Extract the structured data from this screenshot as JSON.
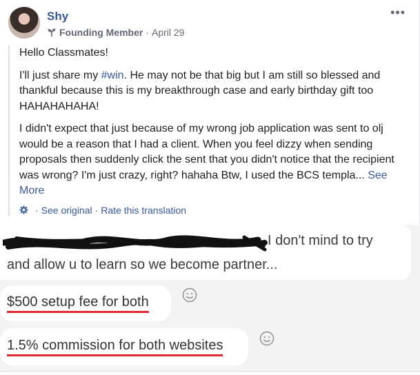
{
  "post": {
    "author": "Shy",
    "badge": "Founding Member",
    "separator": "·",
    "date": "April 29",
    "more_icon": "more-dots-icon",
    "greeting": "Hello Classmates!",
    "p2_before": "I'll just share my ",
    "p2_hashtag": "#win",
    "p2_after": ". He may not be that big but I am still so blessed and thankful because this is my breakthrough case and early birthday gift too HAHAHAHAHA!",
    "p3_text": "I didn't expect that just because of my wrong job application was sent to olj would be a reason that I had a client. When you feel dizzy when sending proposals then suddenly click the sent that you didn't notice that the recipient was wrong? I'm just crazy, right? hahaha Btw, I used the BCS templa...",
    "see_more": "See More",
    "see_original": "See original",
    "rate_translation": "Rate this translation"
  },
  "chat": {
    "top_line1": "I don't mind to try",
    "top_line2": "and allow u to learn so we become partner...",
    "message1": "$500 setup fee for both",
    "message2": "1.5% commission for both websites",
    "underline_color": "#e0262f"
  }
}
